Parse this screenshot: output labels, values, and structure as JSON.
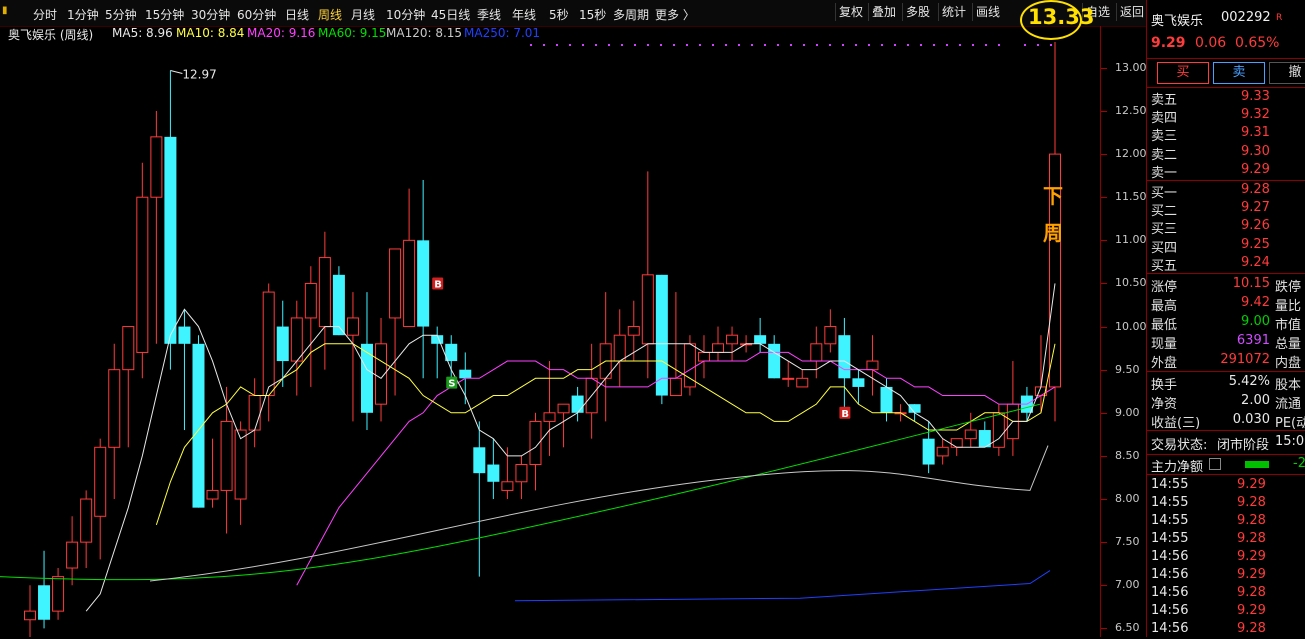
{
  "toolbar": {
    "periods": [
      "分时",
      "1分钟",
      "5分钟",
      "15分钟",
      "30分钟",
      "60分钟",
      "日线",
      "周线",
      "月线",
      "10分钟",
      "45日线",
      "季线",
      "年线",
      "5秒",
      "15秒",
      "多周期",
      "更多 〉"
    ],
    "active_period": "周线",
    "buttons": [
      "复权",
      "叠加",
      "多股",
      "统计",
      "画线",
      "自选",
      "返回"
    ]
  },
  "ma_bar": {
    "title": "奥飞娱乐 (周线)",
    "ma5": "MA5: 8.96",
    "ma10": "MA10: 8.84",
    "ma20": "MA20: 9.16",
    "ma60": "MA60: 9.15",
    "ma120": "MA120: 8.15",
    "ma250": "MA250: 7.01",
    "colors": {
      "ma5": "#e8e8e8",
      "ma10": "#ffff40",
      "ma20": "#ff40ff",
      "ma60": "#00e000",
      "ma120": "#c8c8c8",
      "ma250": "#2040ff"
    }
  },
  "annotation": {
    "high_label": "12.97",
    "target_price": "13.33",
    "note_char1": "下",
    "note_char2": "周",
    "b_mark": "B",
    "s_mark": "S"
  },
  "price_axis": [
    "13.00",
    "12.50",
    "12.00",
    "11.50",
    "11.00",
    "10.50",
    "10.00",
    "9.50",
    "9.00",
    "8.50",
    "8.00",
    "7.50",
    "7.00",
    "6.50"
  ],
  "chart_data": {
    "type": "candlestick",
    "ylim": [
      6.4,
      13.3
    ],
    "candles": [
      {
        "o": 6.6,
        "h": 7.0,
        "l": 6.4,
        "c": 6.7
      },
      {
        "o": 7.0,
        "h": 7.4,
        "l": 6.5,
        "c": 6.6
      },
      {
        "o": 6.7,
        "h": 7.2,
        "l": 6.6,
        "c": 7.1
      },
      {
        "o": 7.2,
        "h": 7.8,
        "l": 7.0,
        "c": 7.5
      },
      {
        "o": 7.5,
        "h": 8.1,
        "l": 7.2,
        "c": 8.0
      },
      {
        "o": 7.8,
        "h": 8.7,
        "l": 7.3,
        "c": 8.6
      },
      {
        "o": 8.6,
        "h": 9.8,
        "l": 8.0,
        "c": 9.5
      },
      {
        "o": 9.5,
        "h": 10.0,
        "l": 8.6,
        "c": 10.0
      },
      {
        "o": 9.7,
        "h": 11.9,
        "l": 9.4,
        "c": 11.5
      },
      {
        "o": 11.5,
        "h": 12.5,
        "l": 9.8,
        "c": 12.2
      },
      {
        "o": 12.2,
        "h": 12.97,
        "l": 9.5,
        "c": 9.8
      },
      {
        "o": 10.0,
        "h": 10.2,
        "l": 8.8,
        "c": 9.8
      },
      {
        "o": 9.8,
        "h": 9.9,
        "l": 7.9,
        "c": 7.9
      },
      {
        "o": 8.0,
        "h": 8.7,
        "l": 7.9,
        "c": 8.1
      },
      {
        "o": 8.1,
        "h": 9.3,
        "l": 7.6,
        "c": 8.9
      },
      {
        "o": 8.0,
        "h": 8.9,
        "l": 7.7,
        "c": 8.8
      },
      {
        "o": 8.8,
        "h": 9.4,
        "l": 8.6,
        "c": 9.2
      },
      {
        "o": 9.2,
        "h": 10.5,
        "l": 8.9,
        "c": 10.4
      },
      {
        "o": 10.0,
        "h": 10.3,
        "l": 9.3,
        "c": 9.6
      },
      {
        "o": 9.6,
        "h": 10.3,
        "l": 9.2,
        "c": 10.1
      },
      {
        "o": 10.1,
        "h": 10.7,
        "l": 9.3,
        "c": 10.5
      },
      {
        "o": 10.0,
        "h": 11.1,
        "l": 9.5,
        "c": 10.8
      },
      {
        "o": 10.6,
        "h": 10.7,
        "l": 9.9,
        "c": 9.9
      },
      {
        "o": 9.9,
        "h": 10.4,
        "l": 8.9,
        "c": 10.1
      },
      {
        "o": 9.8,
        "h": 10.4,
        "l": 8.8,
        "c": 9.0
      },
      {
        "o": 9.1,
        "h": 10.1,
        "l": 8.9,
        "c": 9.8
      },
      {
        "o": 10.1,
        "h": 10.9,
        "l": 9.2,
        "c": 10.9
      },
      {
        "o": 10.0,
        "h": 11.6,
        "l": 10.0,
        "c": 11.0
      },
      {
        "o": 11.0,
        "h": 11.7,
        "l": 9.4,
        "c": 10.0
      },
      {
        "o": 9.9,
        "h": 10.0,
        "l": 9.4,
        "c": 9.8
      },
      {
        "o": 9.8,
        "h": 9.9,
        "l": 9.3,
        "c": 9.6
      },
      {
        "o": 9.5,
        "h": 9.7,
        "l": 9.1,
        "c": 9.4
      },
      {
        "o": 8.6,
        "h": 8.9,
        "l": 7.1,
        "c": 8.3
      },
      {
        "o": 8.4,
        "h": 8.7,
        "l": 8.0,
        "c": 8.2
      },
      {
        "o": 8.1,
        "h": 8.6,
        "l": 8.0,
        "c": 8.2
      },
      {
        "o": 8.2,
        "h": 8.5,
        "l": 8.0,
        "c": 8.4
      },
      {
        "o": 8.4,
        "h": 9.0,
        "l": 8.1,
        "c": 8.9
      },
      {
        "o": 8.9,
        "h": 9.6,
        "l": 8.5,
        "c": 9.0
      },
      {
        "o": 9.0,
        "h": 9.1,
        "l": 8.6,
        "c": 9.1
      },
      {
        "o": 9.2,
        "h": 9.3,
        "l": 8.9,
        "c": 9.0
      },
      {
        "o": 9.0,
        "h": 9.8,
        "l": 8.7,
        "c": 9.4
      },
      {
        "o": 9.4,
        "h": 10.4,
        "l": 8.9,
        "c": 9.8
      },
      {
        "o": 9.6,
        "h": 10.2,
        "l": 9.3,
        "c": 9.9
      },
      {
        "o": 9.9,
        "h": 10.3,
        "l": 9.6,
        "c": 10.0
      },
      {
        "o": 9.8,
        "h": 11.8,
        "l": 9.4,
        "c": 10.6
      },
      {
        "o": 10.6,
        "h": 10.6,
        "l": 9.1,
        "c": 9.2
      },
      {
        "o": 9.2,
        "h": 10.4,
        "l": 9.2,
        "c": 9.4
      },
      {
        "o": 9.3,
        "h": 9.9,
        "l": 9.2,
        "c": 9.8
      },
      {
        "o": 9.6,
        "h": 9.9,
        "l": 9.4,
        "c": 9.7
      },
      {
        "o": 9.7,
        "h": 10.0,
        "l": 9.6,
        "c": 9.8
      },
      {
        "o": 9.8,
        "h": 10.0,
        "l": 9.6,
        "c": 9.9
      },
      {
        "o": 9.8,
        "h": 9.9,
        "l": 9.7,
        "c": 9.8
      },
      {
        "o": 9.9,
        "h": 10.1,
        "l": 9.7,
        "c": 9.8
      },
      {
        "o": 9.8,
        "h": 9.9,
        "l": 9.4,
        "c": 9.4
      },
      {
        "o": 9.4,
        "h": 9.6,
        "l": 9.3,
        "c": 9.4
      },
      {
        "o": 9.3,
        "h": 9.5,
        "l": 9.3,
        "c": 9.4
      },
      {
        "o": 9.6,
        "h": 10.0,
        "l": 9.4,
        "c": 9.8
      },
      {
        "o": 9.8,
        "h": 10.2,
        "l": 9.7,
        "c": 10.0
      },
      {
        "o": 9.9,
        "h": 10.1,
        "l": 9.0,
        "c": 9.4
      },
      {
        "o": 9.4,
        "h": 9.5,
        "l": 9.1,
        "c": 9.3
      },
      {
        "o": 9.5,
        "h": 9.9,
        "l": 9.2,
        "c": 9.6
      },
      {
        "o": 9.3,
        "h": 9.4,
        "l": 8.9,
        "c": 9.0
      },
      {
        "o": 9.0,
        "h": 9.1,
        "l": 8.9,
        "c": 9.0
      },
      {
        "o": 9.1,
        "h": 9.1,
        "l": 8.9,
        "c": 9.0
      },
      {
        "o": 8.7,
        "h": 8.9,
        "l": 8.3,
        "c": 8.4
      },
      {
        "o": 8.5,
        "h": 8.7,
        "l": 8.4,
        "c": 8.6
      },
      {
        "o": 8.6,
        "h": 8.7,
        "l": 8.5,
        "c": 8.7
      },
      {
        "o": 8.7,
        "h": 9.0,
        "l": 8.6,
        "c": 8.8
      },
      {
        "o": 8.8,
        "h": 8.9,
        "l": 8.6,
        "c": 8.6
      },
      {
        "o": 8.6,
        "h": 9.1,
        "l": 8.5,
        "c": 9.0
      },
      {
        "o": 8.7,
        "h": 9.6,
        "l": 8.5,
        "c": 9.1
      },
      {
        "o": 9.2,
        "h": 9.3,
        "l": 8.9,
        "c": 9.0
      },
      {
        "o": 9.2,
        "h": 9.9,
        "l": 9.0,
        "c": 9.3
      },
      {
        "o": 9.3,
        "h": 13.33,
        "l": 8.9,
        "c": 12.0
      }
    ],
    "ma5": [
      null,
      null,
      null,
      null,
      6.7,
      6.9,
      7.4,
      7.9,
      8.5,
      9.2,
      9.9,
      10.2,
      10.0,
      9.6,
      9.1,
      8.7,
      8.8,
      9.3,
      9.4,
      9.6,
      9.8,
      10.0,
      10.0,
      9.8,
      9.5,
      9.4,
      9.6,
      9.8,
      9.9,
      9.9,
      9.5,
      9.2,
      8.8,
      8.7,
      8.5,
      8.5,
      8.6,
      8.8,
      8.9,
      9.0,
      9.2,
      9.4,
      9.6,
      9.7,
      9.8,
      9.8,
      9.8,
      9.8,
      9.7,
      9.7,
      9.7,
      9.8,
      9.8,
      9.7,
      9.6,
      9.5,
      9.5,
      9.6,
      9.6,
      9.5,
      9.4,
      9.3,
      9.2,
      9.0,
      8.9,
      8.7,
      8.6,
      8.6,
      8.6,
      8.7,
      8.9,
      8.9,
      9.3,
      10.5
    ],
    "ma10": [
      null,
      null,
      null,
      null,
      null,
      null,
      null,
      null,
      null,
      7.7,
      8.2,
      8.6,
      8.8,
      9.0,
      9.1,
      9.3,
      9.2,
      9.2,
      9.4,
      9.5,
      9.7,
      9.8,
      9.8,
      9.8,
      9.7,
      9.6,
      9.5,
      9.4,
      9.2,
      9.1,
      9.0,
      9.0,
      9.1,
      9.2,
      9.2,
      9.3,
      9.4,
      9.4,
      9.4,
      9.5,
      9.5,
      9.6,
      9.6,
      9.6,
      9.6,
      9.6,
      9.5,
      9.4,
      9.3,
      9.2,
      9.1,
      9.0,
      9.0,
      8.9,
      8.9,
      9.0,
      9.1,
      9.3,
      9.3,
      9.1,
      9.0,
      9.0,
      9.0,
      8.9,
      8.8,
      8.8,
      8.8,
      8.9,
      9.0,
      9.0,
      8.9,
      8.9,
      9.0,
      9.8
    ],
    "ma20": [
      null,
      null,
      null,
      null,
      null,
      null,
      null,
      null,
      null,
      null,
      null,
      null,
      null,
      null,
      null,
      null,
      null,
      null,
      null,
      7.0,
      7.3,
      7.6,
      7.9,
      8.1,
      8.3,
      8.5,
      8.7,
      8.9,
      9.0,
      9.2,
      9.3,
      9.4,
      9.4,
      9.5,
      9.6,
      9.6,
      9.6,
      9.5,
      9.5,
      9.4,
      9.4,
      9.3,
      9.3,
      9.3,
      9.3,
      9.4,
      9.4,
      9.5,
      9.6,
      9.6,
      9.6,
      9.6,
      9.7,
      9.7,
      9.7,
      9.6,
      9.6,
      9.6,
      9.5,
      9.5,
      9.5,
      9.4,
      9.4,
      9.3,
      9.3,
      9.2,
      9.2,
      9.2,
      9.2,
      9.1,
      9.1,
      9.1,
      9.2,
      9.3
    ]
  },
  "stock": {
    "name": "奥飞娱乐",
    "code": "002292",
    "badge": "R",
    "price": "9.29",
    "change": "0.06",
    "change_pct": "0.65%"
  },
  "trade_buttons": {
    "buy": "买",
    "sell": "卖",
    "cancel": "撤"
  },
  "order_book": {
    "asks": [
      {
        "label": "卖五",
        "price": "9.33"
      },
      {
        "label": "卖四",
        "price": "9.32"
      },
      {
        "label": "卖三",
        "price": "9.31"
      },
      {
        "label": "卖二",
        "price": "9.30"
      },
      {
        "label": "卖一",
        "price": "9.29"
      }
    ],
    "bids": [
      {
        "label": "买一",
        "price": "9.28"
      },
      {
        "label": "买二",
        "price": "9.27"
      },
      {
        "label": "买三",
        "price": "9.26"
      },
      {
        "label": "买四",
        "price": "9.25"
      },
      {
        "label": "买五",
        "price": "9.24"
      }
    ]
  },
  "stats": [
    {
      "l1": "涨停",
      "v1": "10.15",
      "l2": "跌停",
      "c1": "red"
    },
    {
      "l1": "最高",
      "v1": "9.42",
      "l2": "量比",
      "c1": "red"
    },
    {
      "l1": "最低",
      "v1": "9.00",
      "l2": "市值",
      "c1": "green"
    },
    {
      "l1": "现量",
      "v1": "6391",
      "l2": "总量",
      "c1": "purple"
    },
    {
      "l1": "外盘",
      "v1": "291072",
      "l2": "内盘",
      "c1": "red"
    },
    {
      "l1": "换手",
      "v1": "5.42%",
      "l2": "股本",
      "c1": "white"
    },
    {
      "l1": "净资",
      "v1": "2.00",
      "l2": "流通",
      "c1": "white"
    },
    {
      "l1": "收益(三)",
      "v1": "0.030",
      "l2": "PE(动",
      "c1": "white"
    }
  ],
  "trade_status": {
    "label": "交易状态:",
    "value": "闭市阶段",
    "time": "15:00"
  },
  "capital": {
    "label": "主力净额",
    "value": "-2"
  },
  "ticks": [
    {
      "time": "14:55",
      "price": "9.29"
    },
    {
      "time": "14:55",
      "price": "9.28"
    },
    {
      "time": "14:55",
      "price": "9.28"
    },
    {
      "time": "14:55",
      "price": "9.28"
    },
    {
      "time": "14:56",
      "price": "9.29"
    },
    {
      "time": "14:56",
      "price": "9.29"
    },
    {
      "time": "14:56",
      "price": "9.28"
    },
    {
      "time": "14:56",
      "price": "9.29"
    },
    {
      "time": "14:56",
      "price": "9.28"
    }
  ]
}
